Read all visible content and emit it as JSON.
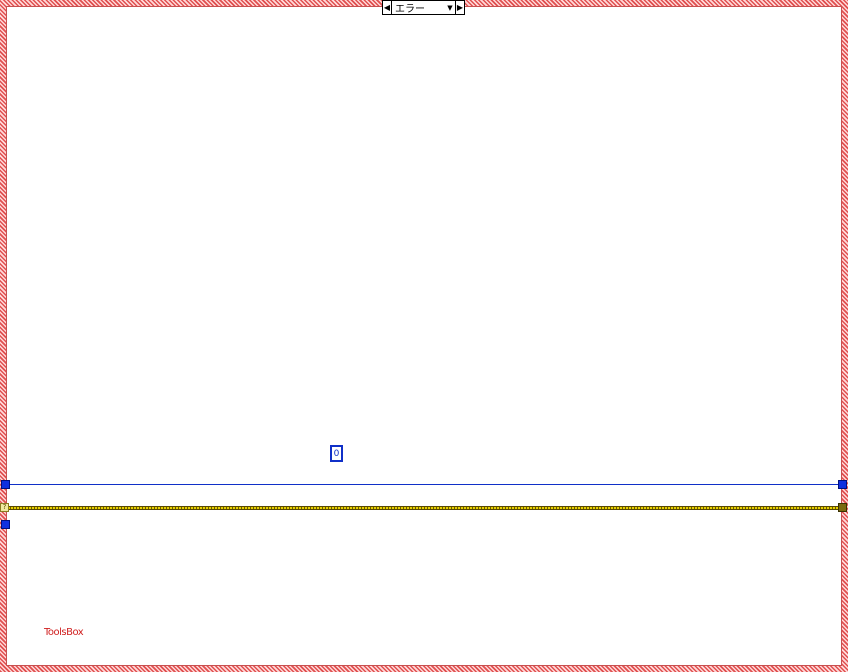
{
  "case_structure": {
    "selector_label": "エラー",
    "left_arrow_icon": "◀",
    "right_arrow_icon": "▶",
    "dropdown_icon": "▼",
    "frame_color": "#e05050"
  },
  "constants": {
    "numeric_zero": "0"
  },
  "tunnels": {
    "error_in_glyph": "?"
  },
  "labels": {
    "toolsbox": "ToolsBox"
  },
  "colors": {
    "integer_wire": "#1030c8",
    "error_wire": "#e8d000",
    "label_red": "#d02020"
  }
}
